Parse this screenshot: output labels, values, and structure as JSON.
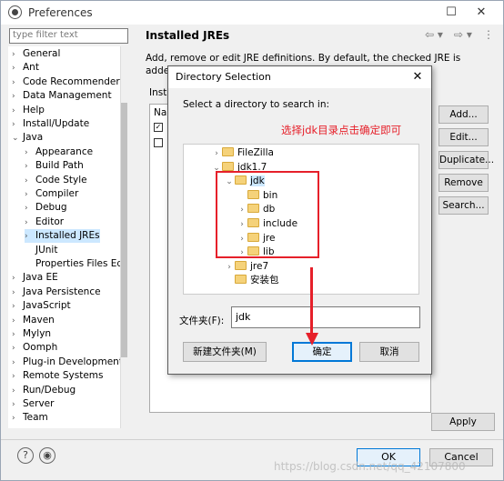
{
  "window": {
    "title": "Preferences",
    "minimize": "☐",
    "close": "✕"
  },
  "filter": {
    "placeholder": "type filter text"
  },
  "tree": [
    {
      "label": "General",
      "expander": "›",
      "indent": 0
    },
    {
      "label": "Ant",
      "expander": "›",
      "indent": 0
    },
    {
      "label": "Code Recommenders",
      "expander": "›",
      "indent": 0
    },
    {
      "label": "Data Management",
      "expander": "›",
      "indent": 0
    },
    {
      "label": "Help",
      "expander": "›",
      "indent": 0
    },
    {
      "label": "Install/Update",
      "expander": "›",
      "indent": 0
    },
    {
      "label": "Java",
      "expander": "⌄",
      "indent": 0
    },
    {
      "label": "Appearance",
      "expander": "›",
      "indent": 1
    },
    {
      "label": "Build Path",
      "expander": "›",
      "indent": 1
    },
    {
      "label": "Code Style",
      "expander": "›",
      "indent": 1
    },
    {
      "label": "Compiler",
      "expander": "›",
      "indent": 1
    },
    {
      "label": "Debug",
      "expander": "›",
      "indent": 1
    },
    {
      "label": "Editor",
      "expander": "›",
      "indent": 1
    },
    {
      "label": "Installed JREs",
      "expander": "›",
      "indent": 1,
      "selected": true
    },
    {
      "label": "JUnit",
      "expander": "",
      "indent": 1
    },
    {
      "label": "Properties Files Ed",
      "expander": "",
      "indent": 1
    },
    {
      "label": "Java EE",
      "expander": "›",
      "indent": 0
    },
    {
      "label": "Java Persistence",
      "expander": "›",
      "indent": 0
    },
    {
      "label": "JavaScript",
      "expander": "›",
      "indent": 0
    },
    {
      "label": "Maven",
      "expander": "›",
      "indent": 0
    },
    {
      "label": "Mylyn",
      "expander": "›",
      "indent": 0
    },
    {
      "label": "Oomph",
      "expander": "›",
      "indent": 0
    },
    {
      "label": "Plug-in Development",
      "expander": "›",
      "indent": 0
    },
    {
      "label": "Remote Systems",
      "expander": "›",
      "indent": 0
    },
    {
      "label": "Run/Debug",
      "expander": "›",
      "indent": 0
    },
    {
      "label": "Server",
      "expander": "›",
      "indent": 0
    },
    {
      "label": "Team",
      "expander": "›",
      "indent": 0
    }
  ],
  "page": {
    "title": "Installed JREs",
    "description": "Add, remove or edit JRE definitions. By default, the checked JRE is added to the build",
    "installed_label": "Insta",
    "table_header": "Nan",
    "buttons": [
      "Add...",
      "Edit...",
      "Duplicate...",
      "Remove",
      "Search..."
    ],
    "apply": "Apply"
  },
  "footer": {
    "ok": "OK",
    "cancel": "Cancel",
    "help": "?",
    "import": "◉"
  },
  "watermark": "https://blog.csdn.net/qq_42107800",
  "dialog": {
    "title": "Directory Selection",
    "close": "✕",
    "prompt": "Select a directory to search in:",
    "annotation": "选择jdk目录点击确定即可",
    "folder_label": "文件夹(F):",
    "folder_value": "jdk",
    "new_folder": "新建文件夹(M)",
    "ok": "确定",
    "cancel": "取消",
    "items": [
      {
        "label": "FileZilla",
        "caret": "›",
        "level": 0
      },
      {
        "label": "jdk1.7",
        "caret": "⌄",
        "level": 0
      },
      {
        "label": "jdk",
        "caret": "⌄",
        "level": 1,
        "selected": true
      },
      {
        "label": "bin",
        "caret": "",
        "level": 2
      },
      {
        "label": "db",
        "caret": "›",
        "level": 2
      },
      {
        "label": "include",
        "caret": "›",
        "level": 2
      },
      {
        "label": "jre",
        "caret": "›",
        "level": 2
      },
      {
        "label": "lib",
        "caret": "›",
        "level": 2
      },
      {
        "label": "jre7",
        "caret": "›",
        "level": 1
      },
      {
        "label": "安装包",
        "caret": "",
        "level": 1
      }
    ]
  },
  "colors": {
    "annotation_red": "#e6202a",
    "selection": "#cce8ff",
    "accent": "#0078d7"
  }
}
